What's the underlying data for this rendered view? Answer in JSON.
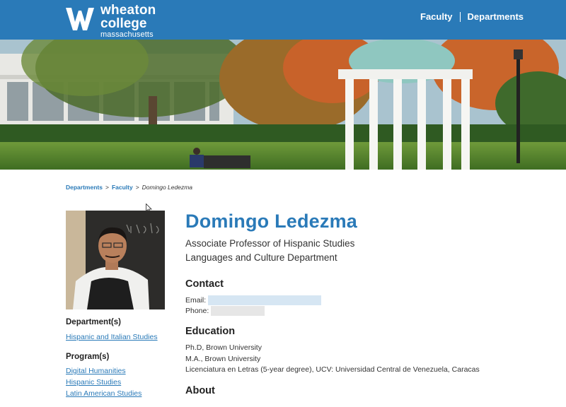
{
  "header": {
    "logo": {
      "line1": "wheaton",
      "line2": "college",
      "line3": "massachusetts"
    },
    "nav": [
      {
        "label": "Faculty"
      },
      {
        "label": "Departments"
      }
    ]
  },
  "breadcrumb": {
    "items": [
      {
        "label": "Departments"
      },
      {
        "label": "Faculty"
      }
    ],
    "current": "Domingo Ledezma",
    "separator": ">"
  },
  "profile": {
    "name": "Domingo Ledezma",
    "title": "Associate Professor of Hispanic Studies",
    "department_line": "Languages and Culture Department"
  },
  "sidebar": {
    "departments_heading": "Department(s)",
    "departments": [
      {
        "label": "Hispanic and Italian Studies"
      }
    ],
    "programs_heading": "Program(s)",
    "programs": [
      {
        "label": "Digital Humanities"
      },
      {
        "label": "Hispanic Studies"
      },
      {
        "label": "Latin American Studies"
      }
    ]
  },
  "contact": {
    "heading": "Contact",
    "email_label": "Email:",
    "phone_label": "Phone:"
  },
  "education": {
    "heading": "Education",
    "items": [
      "Ph.D, Brown University",
      "M.A., Brown University",
      "Licenciatura en Letras (5-year degree), UCV: Universidad Central de Venezuela, Caracas"
    ]
  },
  "about": {
    "heading": "About"
  },
  "colors": {
    "brand_blue": "#2a7ab8",
    "link_blue": "#2a7ab8",
    "redaction_email": "#d6e6f3",
    "redaction_phone": "#e6e6e6"
  }
}
